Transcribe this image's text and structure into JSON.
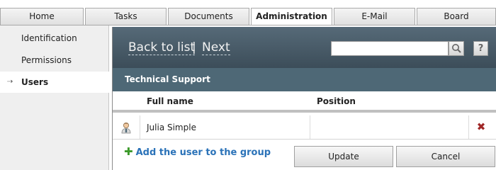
{
  "tabs": [
    {
      "label": "Home"
    },
    {
      "label": "Tasks"
    },
    {
      "label": "Documents"
    },
    {
      "label": "Administration",
      "active": true
    },
    {
      "label": "E-Mail"
    },
    {
      "label": "Board"
    }
  ],
  "sidebar": {
    "items": [
      {
        "label": "Identification"
      },
      {
        "label": "Permissions"
      },
      {
        "label": "Users",
        "active": true,
        "arrow": "⇢"
      }
    ]
  },
  "header": {
    "back_label": "Back to list",
    "separator": "|",
    "next_label": "Next",
    "search": {
      "value": "",
      "placeholder": ""
    },
    "search_icon": "magnifier-icon",
    "help_label": "?"
  },
  "group": {
    "title": "Technical Support"
  },
  "table": {
    "columns": [
      "Full name",
      "Position"
    ],
    "rows": [
      {
        "icon": "user-icon",
        "full_name": "Julia Simple",
        "position": "",
        "delete_icon": "delete-icon"
      }
    ]
  },
  "actions": {
    "add_user_label": "Add the user to the group",
    "update_label": "Update",
    "cancel_label": "Cancel"
  },
  "colors": {
    "header_bg": "#3c4d59",
    "group_bg": "#4e6876",
    "link": "#2a72b8",
    "delete": "#a02828",
    "add": "#3c9a2a"
  }
}
